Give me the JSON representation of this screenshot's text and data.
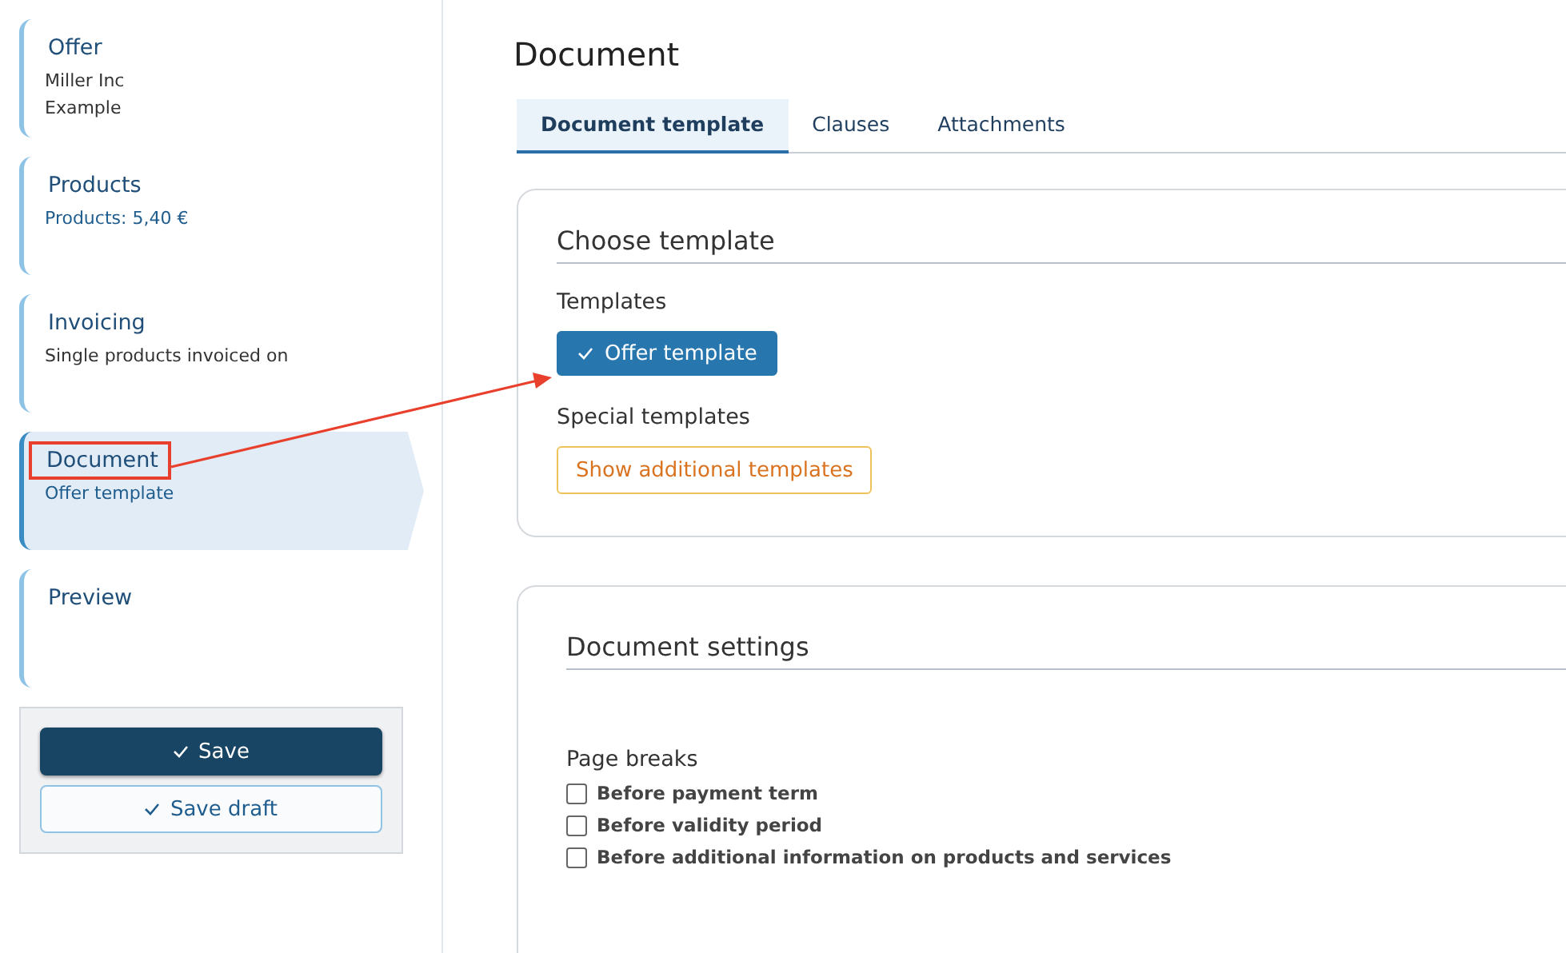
{
  "sidebar": {
    "steps": [
      {
        "title": "Offer",
        "lines": [
          "Miller Inc",
          "Example"
        ],
        "kind": "plain",
        "selected": false,
        "highlighted": false
      },
      {
        "title": "Products",
        "lines": [
          "Products: 5,40 €"
        ],
        "kind": "accent",
        "selected": false,
        "highlighted": false
      },
      {
        "title": "Invoicing",
        "lines": [
          "Single products invoiced on"
        ],
        "kind": "plain",
        "selected": false,
        "highlighted": false
      },
      {
        "title": "Document",
        "lines": [
          "Offer template"
        ],
        "kind": "accent",
        "selected": true,
        "highlighted": true
      },
      {
        "title": "Preview",
        "selected": false,
        "highlighted": false
      }
    ],
    "buttons": [
      {
        "label": "Save",
        "kind": "primary"
      },
      {
        "label": "Save draft",
        "kind": "secondary"
      }
    ]
  },
  "page": {
    "title": "Document",
    "tabs": [
      {
        "label": "Document template",
        "selected": true
      },
      {
        "label": "Clauses",
        "selected": false
      },
      {
        "label": "Attachments",
        "selected": false
      }
    ],
    "choose_template": {
      "heading": "Choose template",
      "templates_label": "Templates",
      "templates": [
        {
          "label": "Offer template",
          "selected": true
        }
      ],
      "special_label": "Special templates",
      "special_button": "Show additional templates"
    },
    "document_settings": {
      "heading": "Document settings",
      "page_breaks_label": "Page breaks",
      "options": [
        {
          "label": "Before payment term",
          "checked": false
        },
        {
          "label": "Before validity period",
          "checked": false
        },
        {
          "label": "Before additional information on products and services",
          "checked": false
        }
      ]
    }
  },
  "annotation": {
    "arrow": true
  }
}
